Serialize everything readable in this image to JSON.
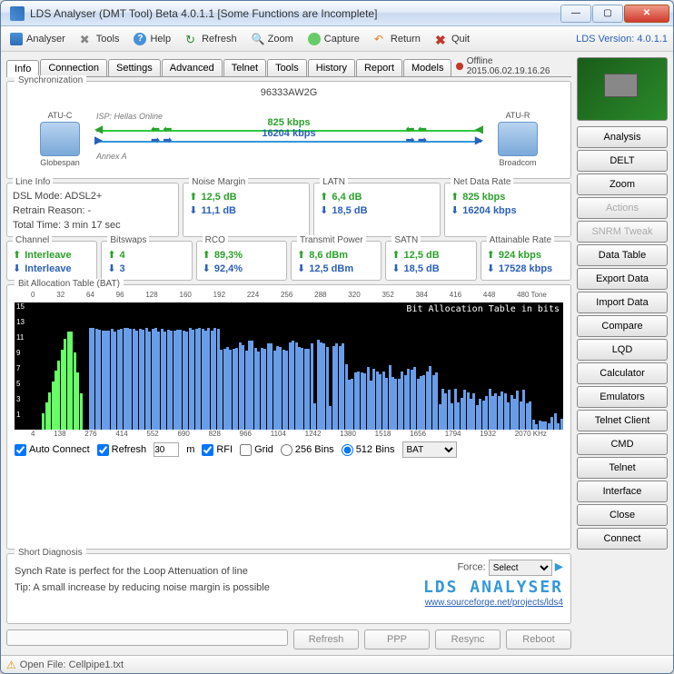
{
  "window": {
    "title": "LDS Analyser (DMT Tool) Beta 4.0.1.1 [Some Functions are Incomplete]"
  },
  "toolbar": {
    "analyser": "Analyser",
    "tools": "Tools",
    "help": "Help",
    "refresh": "Refresh",
    "zoom": "Zoom",
    "capture": "Capture",
    "return": "Return",
    "quit": "Quit",
    "version": "LDS Version: 4.0.1.1"
  },
  "tabs": [
    "Info",
    "Connection",
    "Settings",
    "Advanced",
    "Telnet",
    "Tools",
    "History",
    "Report",
    "Models"
  ],
  "offline": "Offline 2015.06.02.19.16.26",
  "sync": {
    "title": "Synchronization",
    "device_id": "96333AW2G",
    "atu_c": "ATU-C",
    "atu_r": "ATU-R",
    "atu_c_name": "Globespan",
    "atu_r_name": "Broadcom",
    "isp": "ISP: Hellas Online",
    "annex": "Annex A",
    "up_rate": "825 kbps",
    "down_rate": "16204 kbps"
  },
  "line_info": {
    "title": "Line Info",
    "mode_lbl": "DSL Mode: ADSL2+",
    "retrain_lbl": "Retrain Reason: -",
    "time_lbl": "Total Time: 3 min 17 sec"
  },
  "metrics": {
    "noise": {
      "title": "Noise Margin",
      "up": "12,5 dB",
      "dn": "11,1 dB"
    },
    "latn": {
      "title": "LATN",
      "up": "6,4 dB",
      "dn": "18,5 dB"
    },
    "net": {
      "title": "Net Data Rate",
      "up": "825 kbps",
      "dn": "16204 kbps"
    },
    "channel": {
      "title": "Channel",
      "up": "Interleave",
      "dn": "Interleave"
    },
    "bitswaps": {
      "title": "Bitswaps",
      "up": "4",
      "dn": "3"
    },
    "rco": {
      "title": "RCO",
      "up": "89,3%",
      "dn": "92,4%"
    },
    "tx": {
      "title": "Transmit Power",
      "up": "8,6 dBm",
      "dn": "12,5 dBm"
    },
    "satn": {
      "title": "SATN",
      "up": "12,5 dB",
      "dn": "18,5 dB"
    },
    "attain": {
      "title": "Attainable Rate",
      "up": "924 kbps",
      "dn": "17528 kbps"
    }
  },
  "bat": {
    "title": "Bit Allocation Table (BAT)",
    "inner_label": "Bit Allocation Table in bits",
    "top_ticks": [
      "0",
      "32",
      "64",
      "96",
      "128",
      "160",
      "192",
      "224",
      "256",
      "288",
      "320",
      "352",
      "384",
      "416",
      "448",
      "480 Tone"
    ],
    "y_ticks": [
      "15",
      "13",
      "11",
      "9",
      "7",
      "5",
      "3",
      "1"
    ],
    "x_ticks": [
      "4",
      "138",
      "276",
      "414",
      "552",
      "690",
      "828",
      "966",
      "1104",
      "1242",
      "1380",
      "1518",
      "1656",
      "1794",
      "1932",
      "2070 KHz"
    ],
    "auto_connect": "Auto Connect",
    "refresh_lbl": "Refresh",
    "refresh_val": "30",
    "refresh_unit": "m",
    "rfi": "RFI",
    "grid": "Grid",
    "bins256": "256 Bins",
    "bins512": "512 Bins",
    "sel": "BAT"
  },
  "diag": {
    "title": "Short Diagnosis",
    "line1": "Synch Rate is perfect for the Loop Attenuation of line",
    "line2": "Tip: A small increase by reducing noise margin is possible",
    "force": "Force:",
    "force_sel": "Select",
    "logo": "LDS ANALYSER",
    "url": "www.sourceforge.net/projects/lds4"
  },
  "bottom": {
    "refresh": "Refresh",
    "ppp": "PPP",
    "resync": "Resync",
    "reboot": "Reboot"
  },
  "side": [
    "Analysis",
    "DELT",
    "Zoom",
    "Actions",
    "SNRM Tweak",
    "Data Table",
    "Export Data",
    "Import Data",
    "Compare",
    "LQD",
    "Calculator",
    "Emulators",
    "Telnet Client",
    "CMD",
    "Telnet",
    "Interface",
    "Close",
    "Connect"
  ],
  "status": "Open File: Cellpipe1.txt",
  "chart_data": {
    "type": "bar",
    "title": "Bit Allocation Table (BAT)",
    "xlabel": "Tone / KHz",
    "ylabel": "bits",
    "ylim": [
      0,
      15
    ],
    "series": [
      {
        "name": "upstream",
        "color": "#6f6",
        "range_tone": [
          8,
          32
        ],
        "values": [
          2,
          4,
          6,
          8,
          10,
          11,
          12,
          12,
          12,
          12,
          11,
          11,
          10,
          10,
          9,
          9,
          8,
          7,
          6,
          5,
          4,
          3,
          2,
          1
        ]
      },
      {
        "name": "downstream",
        "color": "#6a9de8",
        "range_tone": [
          38,
          500
        ],
        "values_approx": "12-13 bits across tones 38-160 tapering to 10-11 around 160-288 with dips near 256, dropping to 6-9 through 288-384, and 2-6 from 384-500"
      }
    ]
  }
}
